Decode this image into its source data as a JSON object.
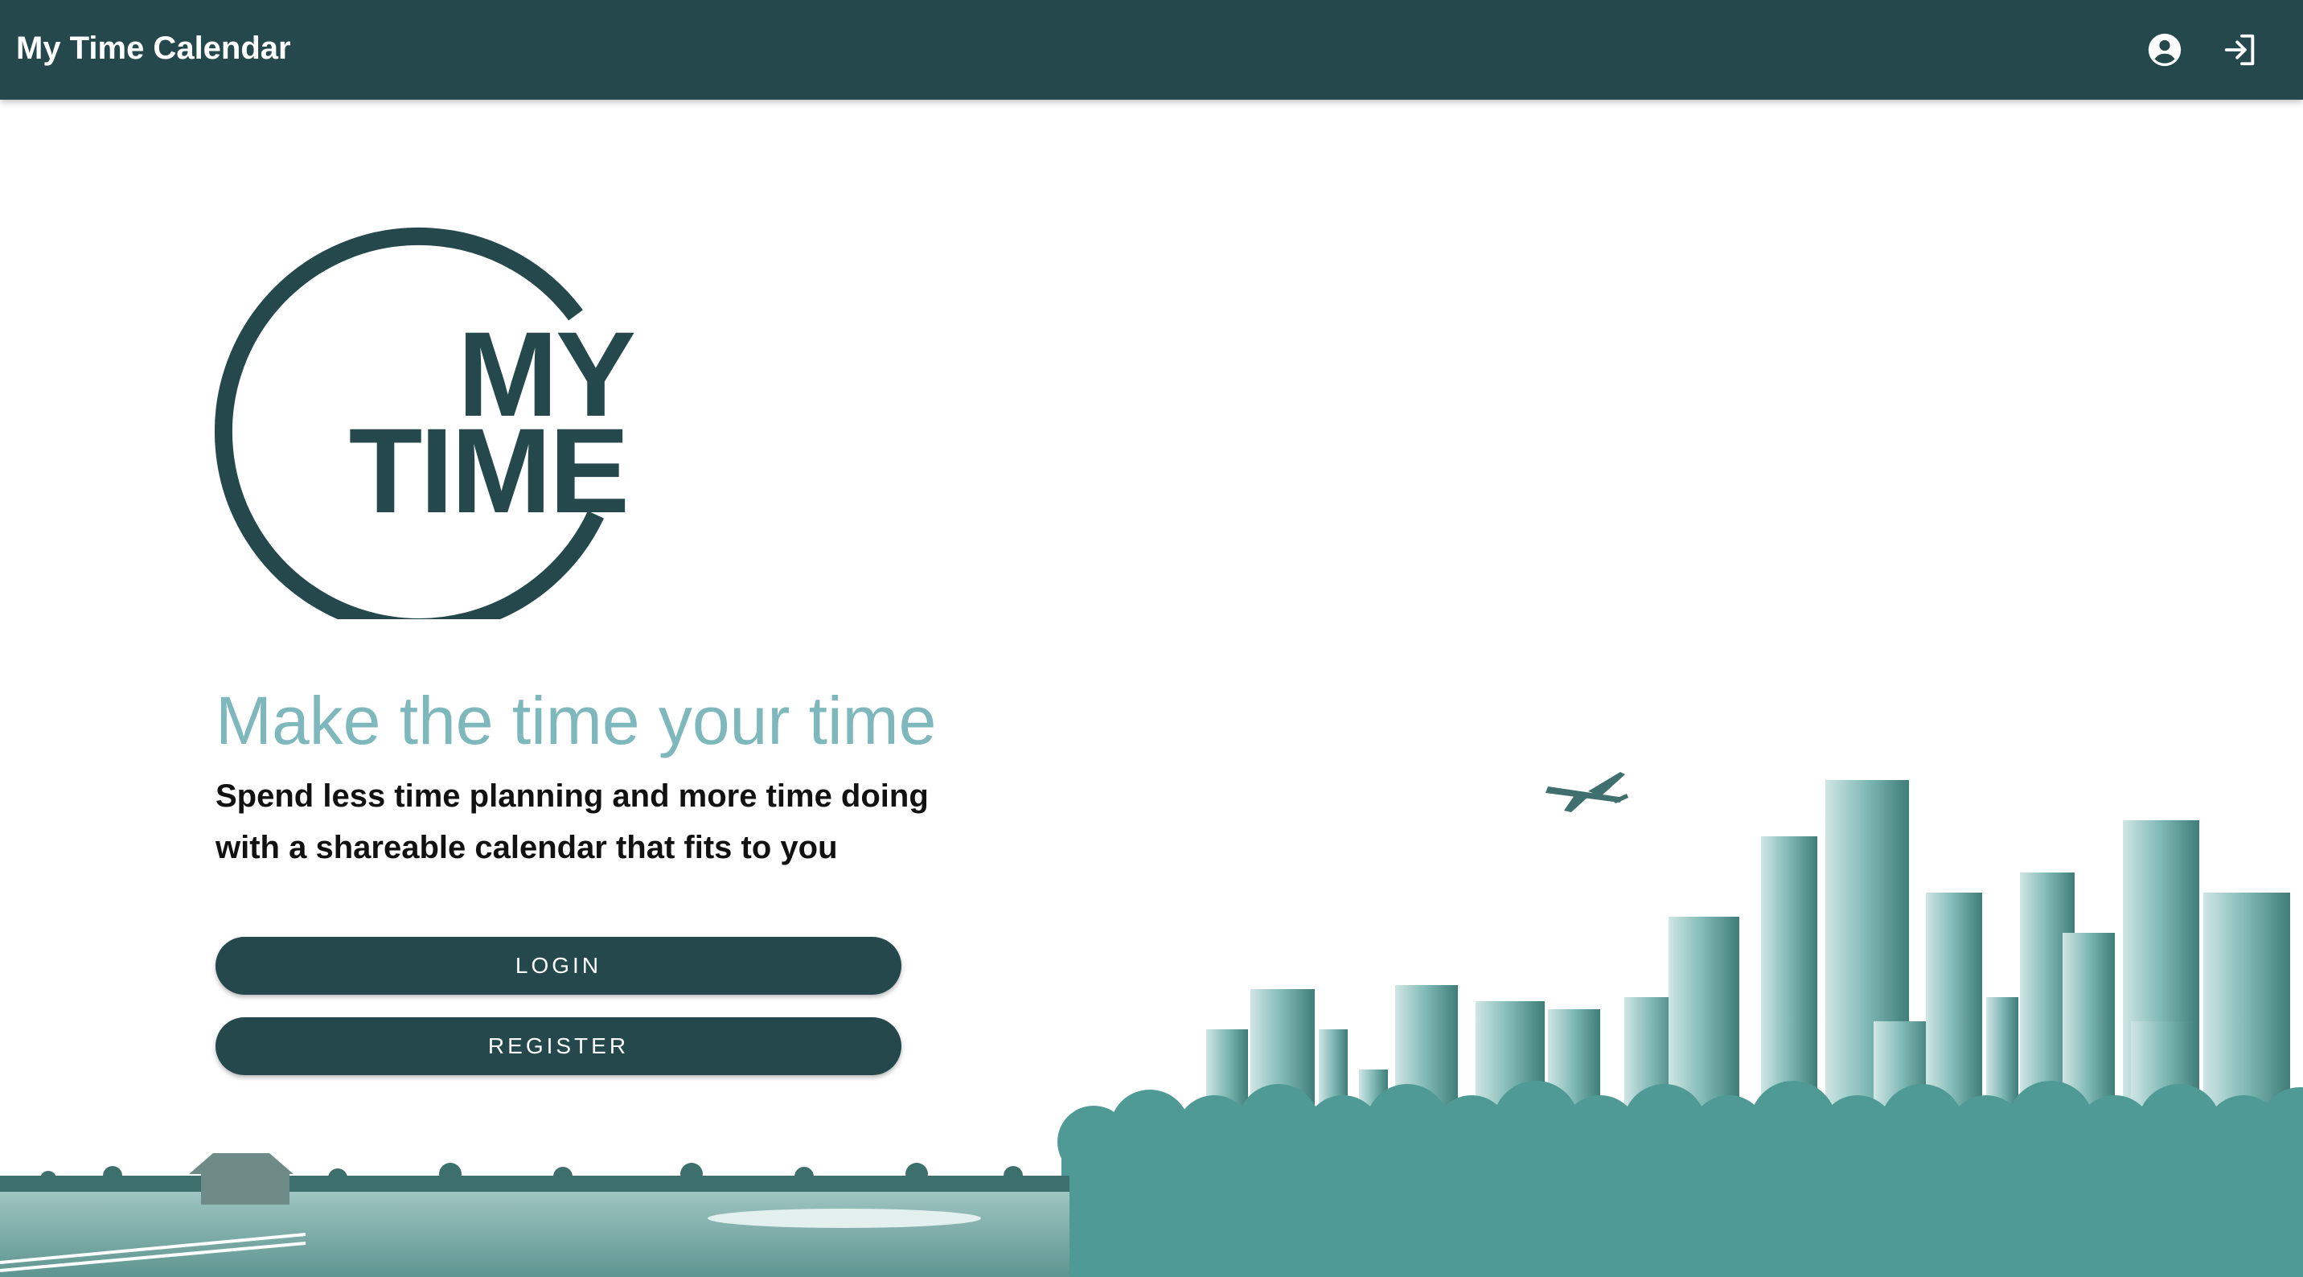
{
  "app": {
    "title": "My Time Calendar"
  },
  "header": {
    "icons": [
      "account-circle-icon",
      "login-icon"
    ]
  },
  "logo": {
    "line1": "MY",
    "line2": "TIME"
  },
  "hero": {
    "headline": "Make the time your time",
    "subline1": "Spend less time planning and more time doing",
    "subline2": "with a shareable calendar that fits to you"
  },
  "buttons": {
    "login": "LOGIN",
    "register": "REGISTER"
  },
  "colors": {
    "primary": "#25484d",
    "accent": "#7fb8bc",
    "illustration": "#5fa8a4"
  }
}
